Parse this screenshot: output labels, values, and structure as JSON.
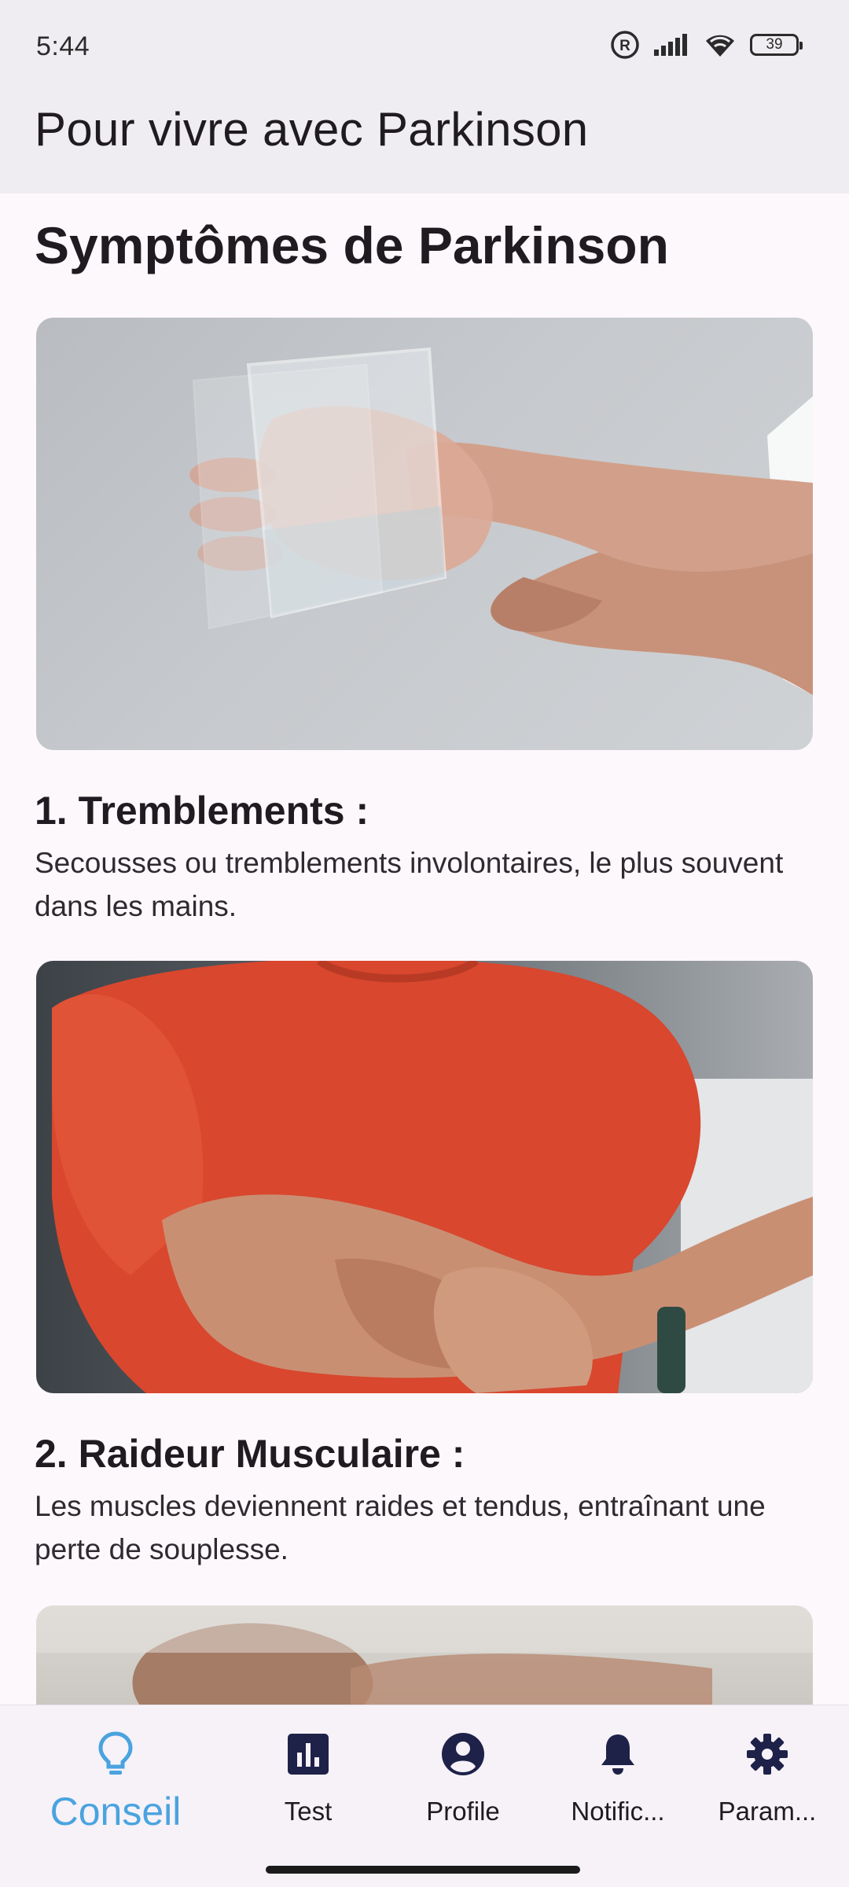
{
  "status_bar": {
    "time": "5:44",
    "battery": "39",
    "icons": [
      "registered-icon",
      "signal-icon",
      "wifi-icon",
      "battery-icon"
    ]
  },
  "app_bar": {
    "title": "Pour vivre avec Parkinson"
  },
  "main": {
    "section_title": "Symptômes de Parkinson",
    "symptoms": [
      {
        "heading": "1. Tremblements :",
        "description": "Secousses ou tremblements involontaires, le plus souvent dans les mains."
      },
      {
        "heading": "2. Raideur Musculaire :",
        "description": "Les muscles deviennent raides et tendus, entraînant une perte de souplesse."
      }
    ]
  },
  "bottom_nav": {
    "active": "Conseil",
    "accent_color": "#4aa3df",
    "items": [
      {
        "label": "Conseil",
        "icon": "lightbulb-icon"
      },
      {
        "label": "Test",
        "icon": "bar-chart-icon"
      },
      {
        "label": "Profile",
        "icon": "account-circle-icon"
      },
      {
        "label": "Notific...",
        "icon": "bell-icon"
      },
      {
        "label": "Param...",
        "icon": "gear-icon"
      }
    ]
  }
}
